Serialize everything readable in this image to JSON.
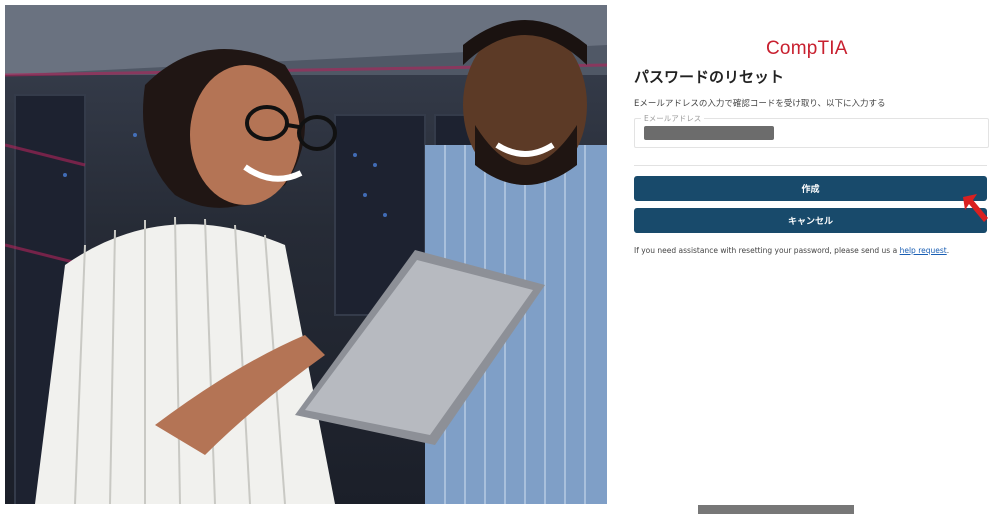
{
  "brand": {
    "logo_text": "CompTIA",
    "color": "#c8202f"
  },
  "page": {
    "title": "パスワードのリセット"
  },
  "form": {
    "instructions": "Eメールアドレスの入力で確認コードを受け取り、以下に入力する",
    "email_label": "Eメールアドレス",
    "email_value_redacted": true
  },
  "buttons": {
    "create_label": "作成",
    "cancel_label": "キャンセル",
    "color": "#184a6b"
  },
  "help": {
    "text": "If you need assistance with resetting your password, please send us a ",
    "link_text": "help request",
    "trailing": "."
  },
  "annotation": {
    "arrow_color": "#d92020"
  },
  "hero": {
    "icon": "hero-photo-people-with-tablet"
  }
}
